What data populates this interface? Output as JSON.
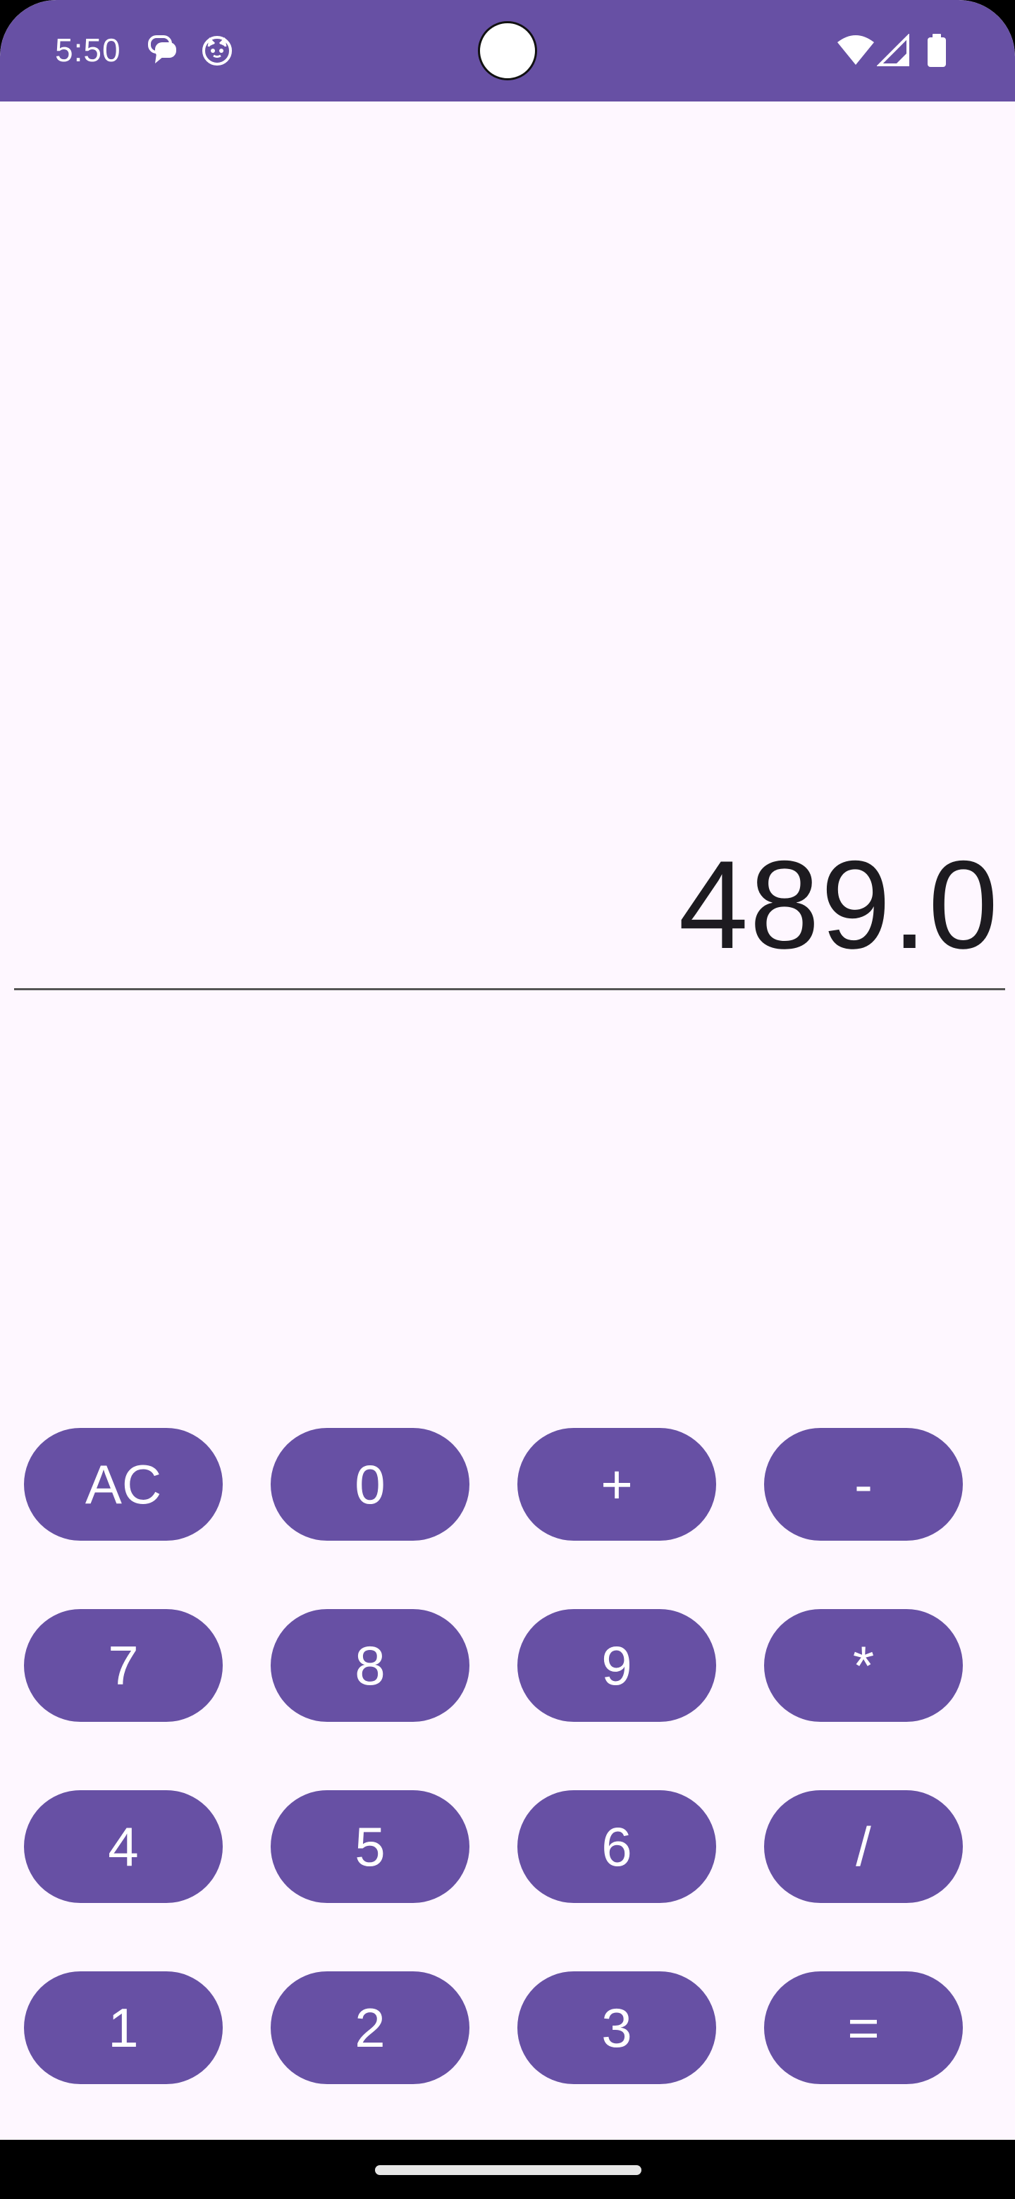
{
  "status_bar": {
    "time": "5:50",
    "background": "#6750A4",
    "notification_icons": [
      "message-icon",
      "cat-face-icon"
    ],
    "system_icons": [
      "wifi-icon",
      "cellular-signal-icon",
      "battery-icon"
    ]
  },
  "display": {
    "value": "489.0"
  },
  "keypad": {
    "key_color": "#6750A4",
    "key_text_color": "#FFFFFF",
    "keys": [
      "AC",
      "0",
      "+",
      "-",
      "7",
      "8",
      "9",
      "*",
      "4",
      "5",
      "6",
      "/",
      "1",
      "2",
      "3",
      "="
    ]
  },
  "colors": {
    "background": "#FEF7FF",
    "display_text": "#1D1B20",
    "nav_bar": "#000000"
  }
}
